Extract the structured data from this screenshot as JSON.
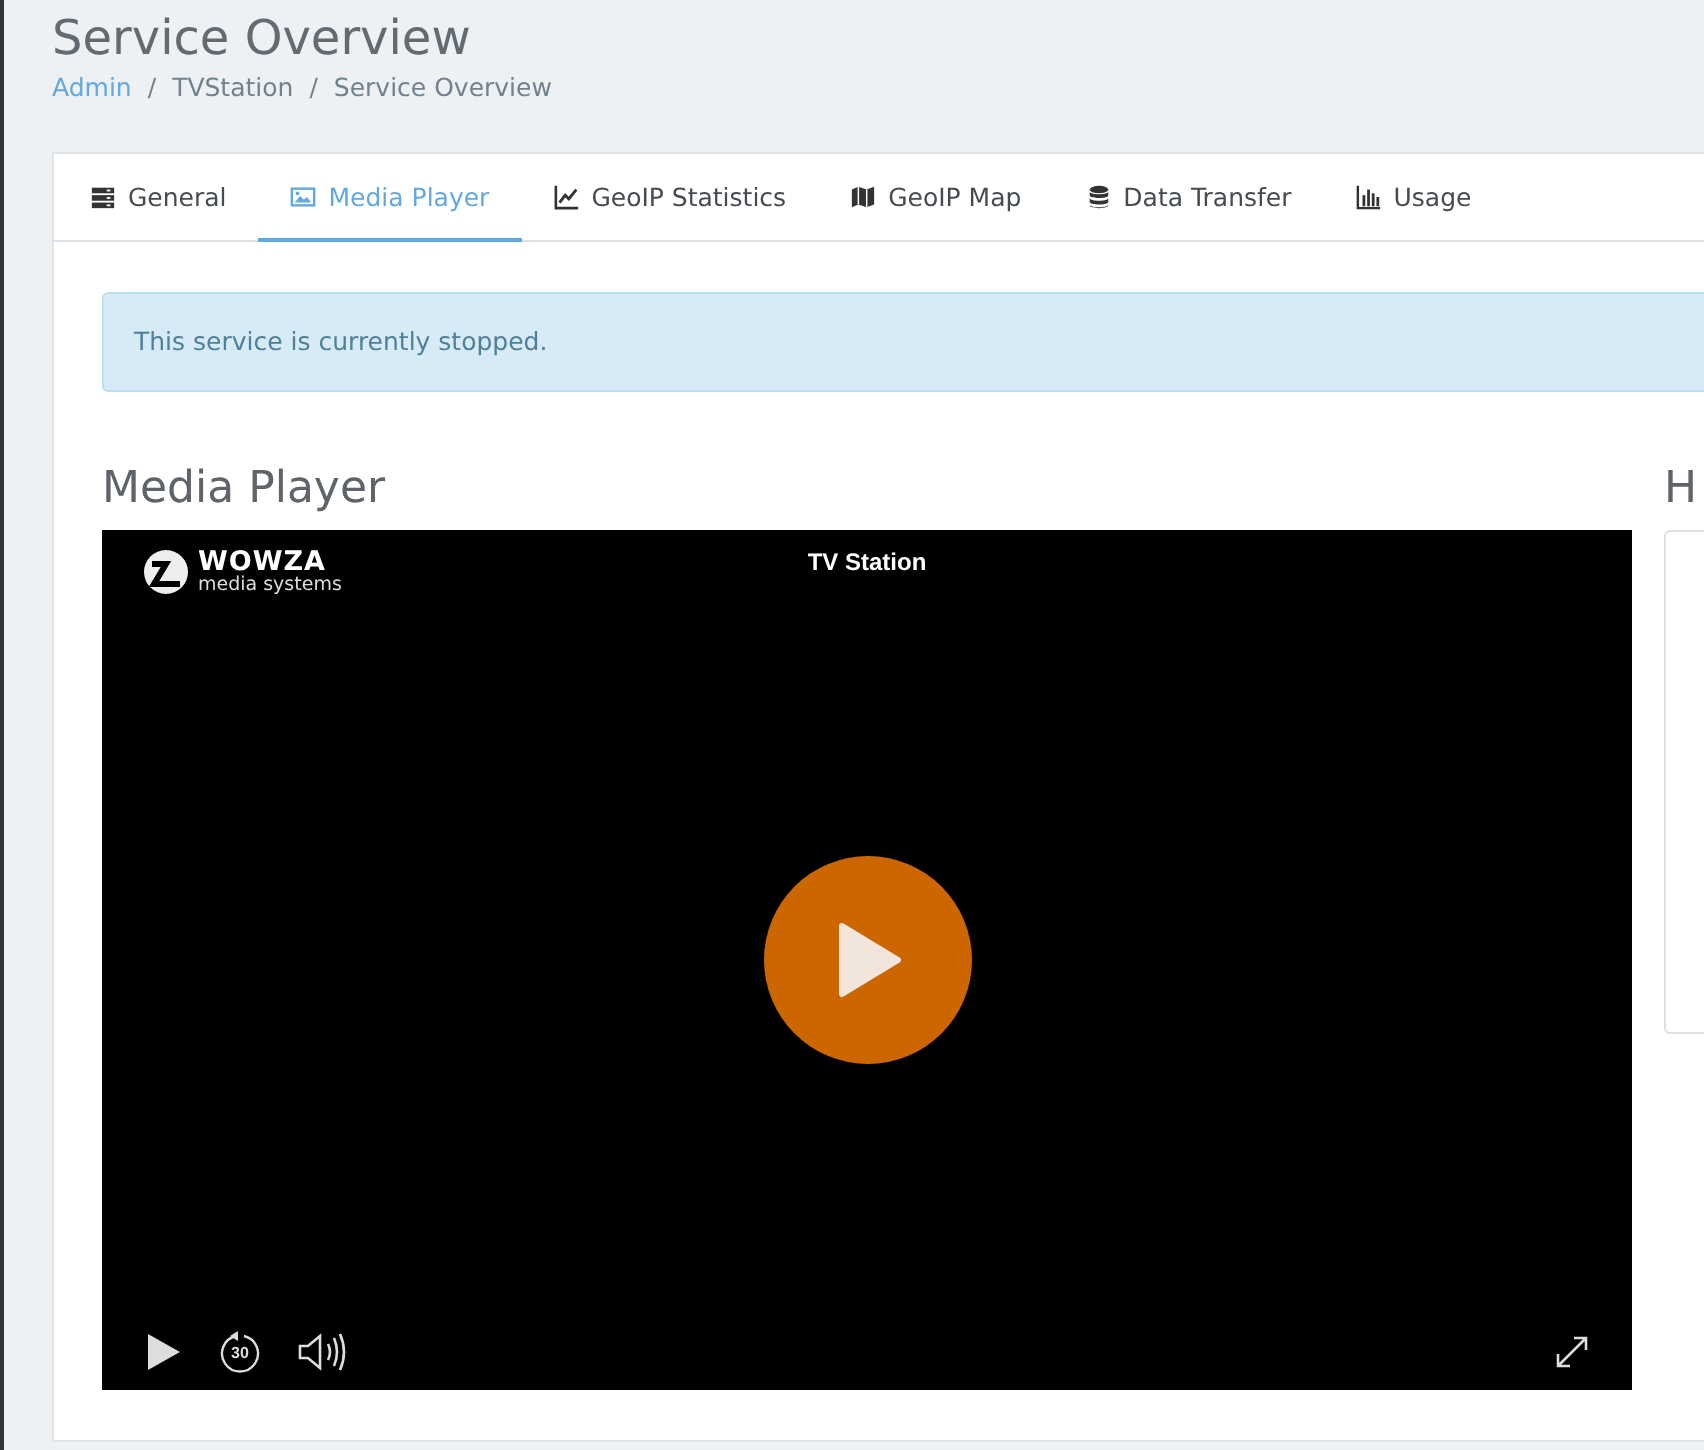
{
  "page": {
    "title": "Service Overview"
  },
  "breadcrumb": [
    {
      "label": "Admin",
      "link": true
    },
    {
      "separator": "/"
    },
    {
      "label": "TVStation",
      "link": false
    },
    {
      "separator": "/"
    },
    {
      "label": "Service Overview",
      "link": false
    }
  ],
  "tabs": [
    {
      "label": "General",
      "kind": "server",
      "selected": false
    },
    {
      "label": "Media Player",
      "kind": "image",
      "selected": true
    },
    {
      "label": "GeoIP Statistics",
      "kind": "trend",
      "selected": false
    },
    {
      "label": "GeoIP Map",
      "kind": "map",
      "selected": false
    },
    {
      "label": "Data Transfer",
      "kind": "database",
      "selected": false
    },
    {
      "label": "Usage",
      "kind": "bars",
      "selected": false
    }
  ],
  "alert": {
    "text": "This service is currently stopped."
  },
  "media_player": {
    "heading": "Media Player",
    "logo": {
      "name": "WOWZA",
      "tagline": "media systems"
    },
    "stream_title": "TV Station",
    "rewind_seconds": "30"
  },
  "side_panel": {
    "heading": "H"
  }
}
